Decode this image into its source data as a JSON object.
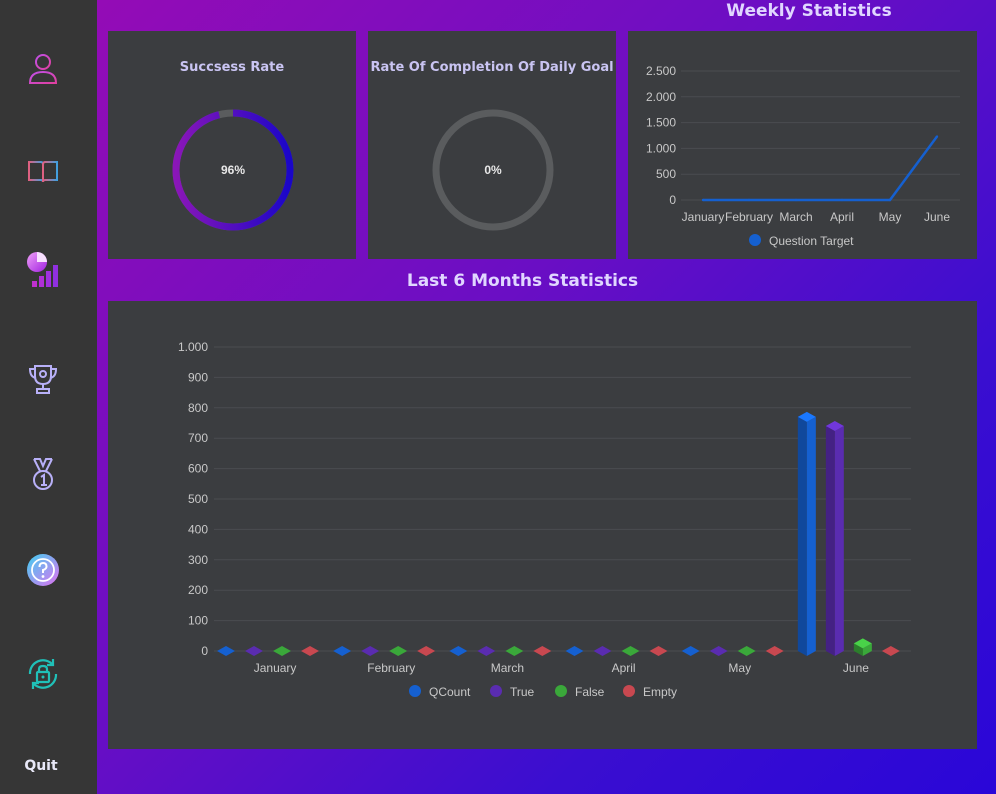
{
  "sidebar": {
    "items": [
      {
        "icon": "user-icon",
        "label": "Profile"
      },
      {
        "icon": "book-icon",
        "label": "Questions"
      },
      {
        "icon": "statistics-icon",
        "label": "Statistics"
      },
      {
        "icon": "trophy-icon",
        "label": "Achievements"
      },
      {
        "icon": "medal-icon",
        "label": "Ranking"
      },
      {
        "icon": "help-icon",
        "label": "Help"
      },
      {
        "icon": "lock-refresh-icon",
        "label": "Change Password"
      }
    ],
    "quit_label": "Quit"
  },
  "success_panel": {
    "title": "Succsess Rate",
    "value_text": "96%",
    "value": 96
  },
  "daily_goal_panel": {
    "title": "Rate Of Completion Of Daily Goal",
    "value_text": "0%",
    "value": 0
  },
  "weekly_title": "Weekly Statistics",
  "monthly_title": "Last 6 Months Statistics",
  "colors": {
    "progress_start": "#8a16b8",
    "progress_end": "#1a06c8",
    "track": "#5a5c5e",
    "question_target": "#1560d0",
    "qcount": "#1560d0",
    "true": "#5a2cb0",
    "false": "#3aa83a",
    "empty": "#c84850"
  },
  "chart_data": [
    {
      "type": "line",
      "categories": [
        "January",
        "February",
        "March",
        "April",
        "May",
        "June"
      ],
      "series": [
        {
          "name": "Question Target",
          "values": [
            0,
            0,
            0,
            0,
            0,
            1230
          ]
        }
      ],
      "yticks": [
        "0",
        "500",
        "1.000",
        "1.500",
        "2.000",
        "2.500"
      ],
      "ylim": [
        0,
        2500
      ],
      "grid": true,
      "legend": "bottom"
    },
    {
      "type": "bar",
      "categories": [
        "January",
        "February",
        "March",
        "April",
        "May",
        "June"
      ],
      "series": [
        {
          "name": "QCount",
          "values": [
            0,
            0,
            0,
            0,
            0,
            770
          ]
        },
        {
          "name": "True",
          "values": [
            0,
            0,
            0,
            0,
            0,
            740
          ]
        },
        {
          "name": "False",
          "values": [
            0,
            0,
            0,
            0,
            0,
            25
          ]
        },
        {
          "name": "Empty",
          "values": [
            0,
            0,
            0,
            0,
            0,
            5
          ]
        }
      ],
      "yticks": [
        "0",
        "100",
        "200",
        "300",
        "400",
        "500",
        "600",
        "700",
        "800",
        "900",
        "1.000"
      ],
      "ylim": [
        0,
        1000
      ],
      "grid": true,
      "legend": "bottom"
    }
  ]
}
